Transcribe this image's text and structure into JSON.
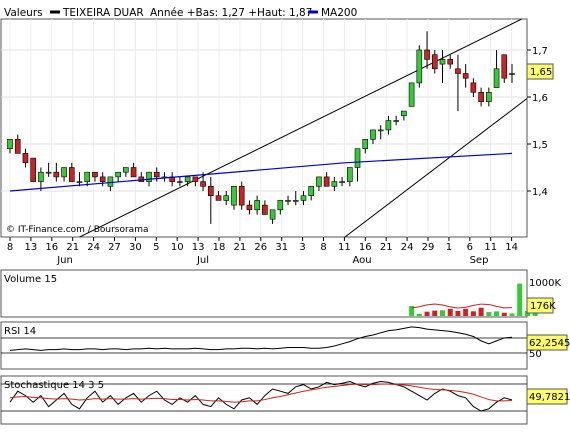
{
  "header": {
    "left_label": "Valeurs",
    "stock_name": "TEIXEIRA DUAR",
    "range_text": "Année +Bas: 1,27 +Haut: 1,87",
    "ma_label": "MA200",
    "ma_color": "#0000cc",
    "price_color": "#000000"
  },
  "copyright": "© IT-Finance.com / Boursorama",
  "colors": {
    "up": "#33cc33",
    "down": "#cc2222",
    "tag_bg": "#ffff66",
    "grid": "#dddddd"
  },
  "chart_data": [
    {
      "type": "candlestick",
      "title": "TEIXEIRA DUAR",
      "x_ticks": [
        "8",
        "13",
        "16",
        "21",
        "24",
        "27",
        "30",
        "5",
        "10",
        "13",
        "18",
        "21",
        "26",
        "31",
        "3",
        "8",
        "11",
        "16",
        "21",
        "24",
        "29",
        "1",
        "6",
        "11",
        "14"
      ],
      "months": [
        "Jun",
        "Jul",
        "Aou",
        "Sep"
      ],
      "y_ticks": [
        "1,4",
        "1,5",
        "1,6",
        "1,7"
      ],
      "ylim": [
        1.3,
        1.75
      ],
      "last_value": "1,65",
      "candles": [
        {
          "o": 1.49,
          "h": 1.51,
          "l": 1.48,
          "c": 1.51
        },
        {
          "o": 1.51,
          "h": 1.52,
          "l": 1.48,
          "c": 1.48
        },
        {
          "o": 1.48,
          "h": 1.49,
          "l": 1.45,
          "c": 1.46
        },
        {
          "o": 1.47,
          "h": 1.47,
          "l": 1.42,
          "c": 1.42
        },
        {
          "o": 1.42,
          "h": 1.45,
          "l": 1.4,
          "c": 1.44
        },
        {
          "o": 1.44,
          "h": 1.46,
          "l": 1.43,
          "c": 1.44
        },
        {
          "o": 1.44,
          "h": 1.46,
          "l": 1.42,
          "c": 1.43
        },
        {
          "o": 1.43,
          "h": 1.45,
          "l": 1.42,
          "c": 1.45
        },
        {
          "o": 1.45,
          "h": 1.46,
          "l": 1.42,
          "c": 1.42
        },
        {
          "o": 1.42,
          "h": 1.44,
          "l": 1.41,
          "c": 1.42
        },
        {
          "o": 1.42,
          "h": 1.44,
          "l": 1.41,
          "c": 1.44
        },
        {
          "o": 1.44,
          "h": 1.44,
          "l": 1.42,
          "c": 1.43
        },
        {
          "o": 1.43,
          "h": 1.44,
          "l": 1.41,
          "c": 1.42
        },
        {
          "o": 1.41,
          "h": 1.43,
          "l": 1.4,
          "c": 1.43
        },
        {
          "o": 1.43,
          "h": 1.44,
          "l": 1.42,
          "c": 1.44
        },
        {
          "o": 1.44,
          "h": 1.45,
          "l": 1.43,
          "c": 1.45
        },
        {
          "o": 1.45,
          "h": 1.46,
          "l": 1.43,
          "c": 1.43
        },
        {
          "o": 1.43,
          "h": 1.44,
          "l": 1.42,
          "c": 1.42
        },
        {
          "o": 1.42,
          "h": 1.44,
          "l": 1.41,
          "c": 1.44
        },
        {
          "o": 1.44,
          "h": 1.45,
          "l": 1.42,
          "c": 1.43
        },
        {
          "o": 1.43,
          "h": 1.44,
          "l": 1.42,
          "c": 1.43
        },
        {
          "o": 1.43,
          "h": 1.44,
          "l": 1.41,
          "c": 1.42
        },
        {
          "o": 1.42,
          "h": 1.43,
          "l": 1.41,
          "c": 1.42
        },
        {
          "o": 1.42,
          "h": 1.43,
          "l": 1.41,
          "c": 1.43
        },
        {
          "o": 1.43,
          "h": 1.43,
          "l": 1.41,
          "c": 1.42
        },
        {
          "o": 1.42,
          "h": 1.44,
          "l": 1.4,
          "c": 1.41
        },
        {
          "o": 1.41,
          "h": 1.43,
          "l": 1.33,
          "c": 1.39
        },
        {
          "o": 1.39,
          "h": 1.4,
          "l": 1.38,
          "c": 1.38
        },
        {
          "o": 1.38,
          "h": 1.4,
          "l": 1.37,
          "c": 1.39
        },
        {
          "o": 1.37,
          "h": 1.41,
          "l": 1.36,
          "c": 1.41
        },
        {
          "o": 1.41,
          "h": 1.42,
          "l": 1.36,
          "c": 1.37
        },
        {
          "o": 1.37,
          "h": 1.38,
          "l": 1.35,
          "c": 1.36
        },
        {
          "o": 1.36,
          "h": 1.39,
          "l": 1.35,
          "c": 1.38
        },
        {
          "o": 1.37,
          "h": 1.38,
          "l": 1.35,
          "c": 1.35
        },
        {
          "o": 1.34,
          "h": 1.36,
          "l": 1.33,
          "c": 1.36
        },
        {
          "o": 1.36,
          "h": 1.38,
          "l": 1.35,
          "c": 1.38
        },
        {
          "o": 1.38,
          "h": 1.39,
          "l": 1.37,
          "c": 1.38
        },
        {
          "o": 1.38,
          "h": 1.4,
          "l": 1.37,
          "c": 1.38
        },
        {
          "o": 1.38,
          "h": 1.4,
          "l": 1.37,
          "c": 1.39
        },
        {
          "o": 1.39,
          "h": 1.41,
          "l": 1.38,
          "c": 1.41
        },
        {
          "o": 1.41,
          "h": 1.43,
          "l": 1.4,
          "c": 1.43
        },
        {
          "o": 1.43,
          "h": 1.44,
          "l": 1.41,
          "c": 1.41
        },
        {
          "o": 1.41,
          "h": 1.43,
          "l": 1.4,
          "c": 1.42
        },
        {
          "o": 1.42,
          "h": 1.43,
          "l": 1.41,
          "c": 1.42
        },
        {
          "o": 1.42,
          "h": 1.45,
          "l": 1.41,
          "c": 1.45
        },
        {
          "o": 1.45,
          "h": 1.48,
          "l": 1.42,
          "c": 1.49
        },
        {
          "o": 1.49,
          "h": 1.51,
          "l": 1.48,
          "c": 1.51
        },
        {
          "o": 1.51,
          "h": 1.53,
          "l": 1.5,
          "c": 1.53
        },
        {
          "o": 1.53,
          "h": 1.54,
          "l": 1.51,
          "c": 1.53
        },
        {
          "o": 1.53,
          "h": 1.56,
          "l": 1.52,
          "c": 1.55
        },
        {
          "o": 1.55,
          "h": 1.56,
          "l": 1.54,
          "c": 1.55
        },
        {
          "o": 1.56,
          "h": 1.57,
          "l": 1.55,
          "c": 1.57
        },
        {
          "o": 1.58,
          "h": 1.63,
          "l": 1.58,
          "c": 1.63
        },
        {
          "o": 1.63,
          "h": 1.71,
          "l": 1.62,
          "c": 1.7
        },
        {
          "o": 1.7,
          "h": 1.74,
          "l": 1.66,
          "c": 1.68
        },
        {
          "o": 1.69,
          "h": 1.7,
          "l": 1.65,
          "c": 1.66
        },
        {
          "o": 1.67,
          "h": 1.7,
          "l": 1.63,
          "c": 1.68
        },
        {
          "o": 1.68,
          "h": 1.69,
          "l": 1.66,
          "c": 1.67
        },
        {
          "o": 1.66,
          "h": 1.69,
          "l": 1.57,
          "c": 1.65
        },
        {
          "o": 1.65,
          "h": 1.67,
          "l": 1.62,
          "c": 1.64
        },
        {
          "o": 1.63,
          "h": 1.64,
          "l": 1.6,
          "c": 1.61
        },
        {
          "o": 1.61,
          "h": 1.62,
          "l": 1.58,
          "c": 1.59
        },
        {
          "o": 1.59,
          "h": 1.62,
          "l": 1.58,
          "c": 1.61
        },
        {
          "o": 1.62,
          "h": 1.7,
          "l": 1.62,
          "c": 1.66
        },
        {
          "o": 1.69,
          "h": 1.69,
          "l": 1.63,
          "c": 1.64
        },
        {
          "o": 1.65,
          "h": 1.67,
          "l": 1.63,
          "c": 1.65
        }
      ],
      "ma200": [
        1.4,
        1.43,
        1.46,
        1.48
      ],
      "channel_upper": [
        [
          -11,
          1.14
        ],
        [
          68,
          1.78
        ]
      ],
      "channel_lower": [
        [
          28,
          1.11
        ],
        [
          68,
          1.61
        ]
      ]
    },
    {
      "type": "bar",
      "title": "Volume 15",
      "y_ticks": [
        "1000K"
      ],
      "last_value": "176K",
      "values": [
        0,
        0,
        0,
        0,
        0,
        0,
        0,
        0,
        0,
        0,
        0,
        0,
        0,
        0,
        0,
        0,
        0,
        0,
        0,
        0,
        0,
        0,
        0,
        0,
        0,
        0,
        0,
        0,
        0,
        0,
        0,
        0,
        0,
        0,
        0,
        0,
        0,
        0,
        0,
        0,
        0,
        0,
        0,
        0,
        0,
        0,
        0,
        0,
        0,
        0,
        0,
        0,
        280,
        60,
        120,
        150,
        160,
        200,
        140,
        200,
        130,
        230,
        110,
        130,
        90,
        70,
        900,
        140,
        120
      ]
    },
    {
      "type": "line",
      "title": "RSI 14",
      "y_ticks": [
        "50"
      ],
      "last_value": "62,2545",
      "values": [
        44,
        45,
        46,
        45,
        44,
        45,
        45,
        46,
        45,
        45,
        46,
        46,
        45,
        46,
        46,
        45,
        46,
        46,
        47,
        46,
        47,
        46,
        46,
        46,
        47,
        46,
        45,
        45,
        46,
        46,
        47,
        47,
        46,
        47,
        46,
        47,
        48,
        48,
        48,
        47,
        47,
        48,
        50,
        53,
        56,
        60,
        63,
        65,
        68,
        71,
        72,
        74,
        76,
        75,
        73,
        72,
        71,
        70,
        68,
        66,
        63,
        57,
        53,
        57,
        61,
        62
      ]
    },
    {
      "type": "line",
      "title": "Stochastique 14 3 5",
      "last_value": "49,7821",
      "series": [
        {
          "values": [
            45,
            70,
            60,
            45,
            60,
            35,
            50,
            65,
            40,
            30,
            55,
            70,
            45,
            60,
            40,
            55,
            65,
            45,
            60,
            70,
            50,
            40,
            55,
            45,
            60,
            40,
            35,
            55,
            40,
            30,
            50,
            55,
            40,
            60,
            75,
            70,
            65,
            80,
            85,
            75,
            80,
            90,
            85,
            88,
            92,
            85,
            80,
            88,
            92,
            90,
            85,
            80,
            70,
            60,
            50,
            65,
            75,
            70,
            60,
            55,
            35,
            25,
            30,
            45,
            55,
            50
          ]
        },
        {
          "values": [
            55,
            57,
            58,
            56,
            55,
            53,
            52,
            53,
            52,
            50,
            51,
            53,
            52,
            53,
            52,
            52,
            53,
            52,
            53,
            54,
            53,
            51,
            51,
            50,
            51,
            50,
            48,
            48,
            47,
            45,
            46,
            48,
            48,
            51,
            55,
            58,
            62,
            66,
            70,
            73,
            76,
            79,
            81,
            83,
            85,
            86,
            85,
            85,
            86,
            86,
            85,
            84,
            82,
            79,
            76,
            74,
            73,
            72,
            70,
            67,
            63,
            57,
            51,
            48,
            48,
            49
          ]
        }
      ]
    }
  ]
}
